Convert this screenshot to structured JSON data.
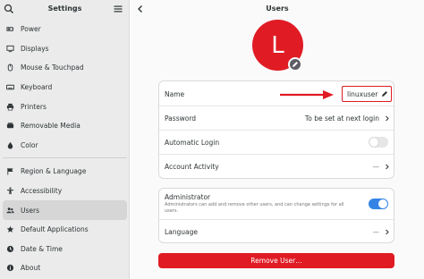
{
  "sidebar": {
    "title": "Settings",
    "items": [
      {
        "label": "Power",
        "icon": "power-icon"
      },
      {
        "label": "Displays",
        "icon": "display-icon"
      },
      {
        "label": "Mouse & Touchpad",
        "icon": "mouse-icon"
      },
      {
        "label": "Keyboard",
        "icon": "keyboard-icon"
      },
      {
        "label": "Printers",
        "icon": "printer-icon"
      },
      {
        "label": "Removable Media",
        "icon": "media-icon"
      },
      {
        "label": "Color",
        "icon": "color-icon"
      },
      {
        "label": "Region & Language",
        "icon": "flag-icon"
      },
      {
        "label": "Accessibility",
        "icon": "accessibility-icon"
      },
      {
        "label": "Users",
        "icon": "users-icon"
      },
      {
        "label": "Default Applications",
        "icon": "star-icon"
      },
      {
        "label": "Date & Time",
        "icon": "clock-icon"
      },
      {
        "label": "About",
        "icon": "info-icon"
      }
    ]
  },
  "main": {
    "title": "Users",
    "avatar_letter": "L",
    "avatar_color": "#e01b24",
    "account": {
      "name_label": "Name",
      "name_value": "linuxuser",
      "password_label": "Password",
      "password_value": "To be set at next login",
      "autologin_label": "Automatic Login",
      "activity_label": "Account Activity",
      "activity_value": "—"
    },
    "admin": {
      "label": "Administrator",
      "description": "Administrators can add and remove other users, and can change settings for all users.",
      "language_label": "Language",
      "language_value": "—"
    },
    "remove_button": "Remove User…"
  },
  "colors": {
    "accent": "#3584e4",
    "destructive": "#e01b24"
  }
}
